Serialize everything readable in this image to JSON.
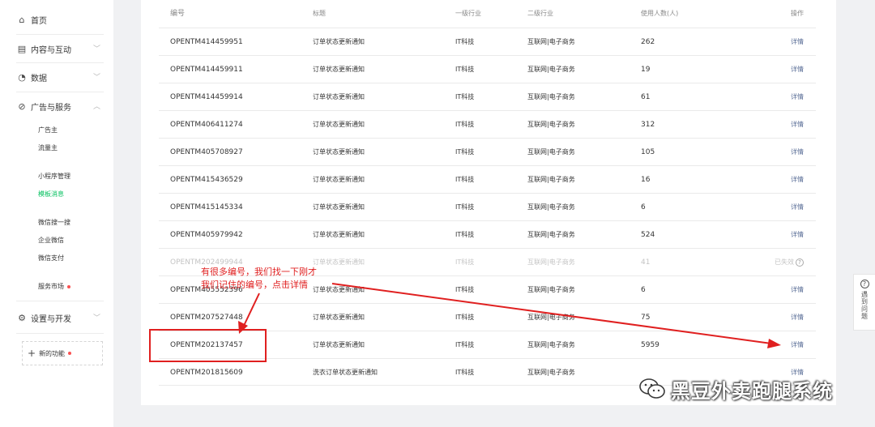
{
  "sidebar": {
    "home": "首页",
    "content": "内容与互动",
    "data": "数据",
    "ads": "广告与服务",
    "advertiser": "广告主",
    "publisher": "流量主",
    "miniprogram": "小程序管理",
    "template_msg": "模板消息",
    "wechat_search": "微信搜一搜",
    "work_wechat": "企业微信",
    "wechat_pay": "微信支付",
    "service_market": "服务市场",
    "settings": "设置与开发",
    "new_features": "新的功能"
  },
  "table": {
    "headers": {
      "code": "编号",
      "title": "标题",
      "industry1": "一级行业",
      "industry2": "二级行业",
      "users": "使用人数(人)",
      "op": "操作"
    },
    "rows": [
      {
        "code": "OPENTM414459951",
        "title": "订单状态更新通知",
        "industry1": "IT科技",
        "industry2": "互联网|电子商务",
        "users": "262",
        "op": "详情"
      },
      {
        "code": "OPENTM414459911",
        "title": "订单状态更新通知",
        "industry1": "IT科技",
        "industry2": "互联网|电子商务",
        "users": "19",
        "op": "详情"
      },
      {
        "code": "OPENTM414459914",
        "title": "订单状态更新通知",
        "industry1": "IT科技",
        "industry2": "互联网|电子商务",
        "users": "61",
        "op": "详情"
      },
      {
        "code": "OPENTM406411274",
        "title": "订单状态更新通知",
        "industry1": "IT科技",
        "industry2": "互联网|电子商务",
        "users": "312",
        "op": "详情"
      },
      {
        "code": "OPENTM405708927",
        "title": "订单状态更新通知",
        "industry1": "IT科技",
        "industry2": "互联网|电子商务",
        "users": "105",
        "op": "详情"
      },
      {
        "code": "OPENTM415436529",
        "title": "订单状态更新通知",
        "industry1": "IT科技",
        "industry2": "互联网|电子商务",
        "users": "16",
        "op": "详情"
      },
      {
        "code": "OPENTM415145334",
        "title": "订单状态更新通知",
        "industry1": "IT科技",
        "industry2": "互联网|电子商务",
        "users": "6",
        "op": "详情"
      },
      {
        "code": "OPENTM405979942",
        "title": "订单状态更新通知",
        "industry1": "IT科技",
        "industry2": "互联网|电子商务",
        "users": "524",
        "op": "详情"
      },
      {
        "code": "OPENTM202499944",
        "title": "订单状态更新通知",
        "industry1": "IT科技",
        "industry2": "互联网|电子商务",
        "users": "41",
        "op": "已失效"
      },
      {
        "code": "OPENTM405552396",
        "title": "订单状态更新通知",
        "industry1": "IT科技",
        "industry2": "互联网|电子商务",
        "users": "6",
        "op": "详情"
      },
      {
        "code": "OPENTM207527448",
        "title": "订单状态更新通知",
        "industry1": "IT科技",
        "industry2": "互联网|电子商务",
        "users": "75",
        "op": "详情"
      },
      {
        "code": "OPENTM202137457",
        "title": "订单状态更新通知",
        "industry1": "IT科技",
        "industry2": "互联网|电子商务",
        "users": "5959",
        "op": "详情"
      },
      {
        "code": "OPENTM201815609",
        "title": "洗衣订单状态更新通知",
        "industry1": "IT科技",
        "industry2": "互联网|电子商务",
        "users": "",
        "op": "详情"
      }
    ]
  },
  "annotation": {
    "line1": "有很多编号，我们找一下刚才",
    "line2": "我们记住的编号，点击详情"
  },
  "help": {
    "label": "遇到问题"
  },
  "watermark": {
    "text": "黑豆外卖跑腿系统",
    "icon": "wechat-icon"
  },
  "colors": {
    "accent_green": "#07c160",
    "link_blue": "#576b95",
    "annotation_red": "#e02020",
    "badge_red": "#fa5151"
  }
}
